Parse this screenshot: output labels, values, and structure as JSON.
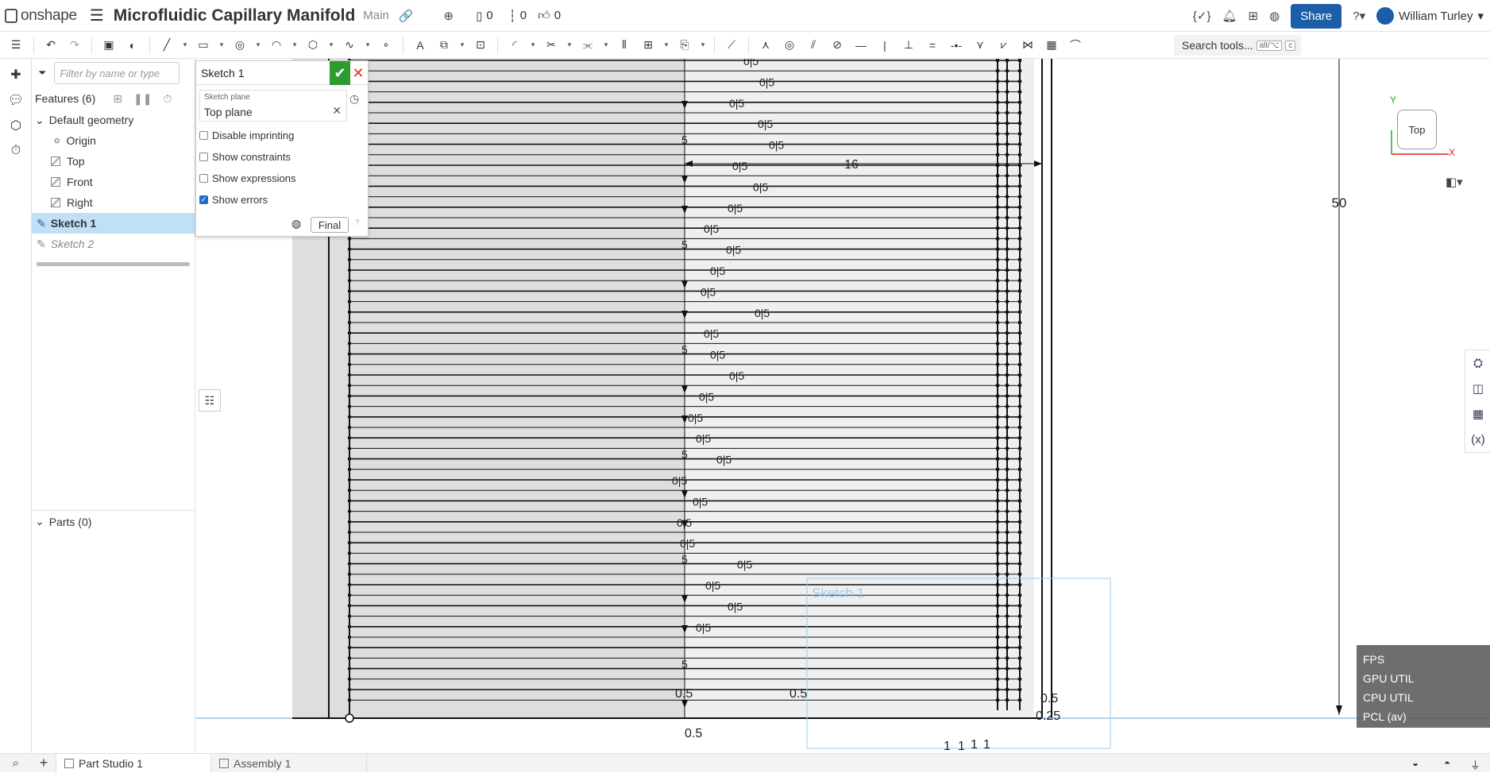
{
  "app": {
    "brand": "onshape",
    "doc_title": "Microfluidic Capillary Manifold",
    "branch": "Main",
    "counters": {
      "versions": "0",
      "branches": "0",
      "likes": "0"
    },
    "share_label": "Share",
    "user_name": "William Turley"
  },
  "toolbar": {
    "search_label": "Search tools...",
    "search_kbd1": "alt/⌥",
    "search_kbd2": "c"
  },
  "features": {
    "filter_placeholder": "Filter by name or type",
    "header": "Features (6)",
    "default_geometry": "Default geometry",
    "items": [
      "Origin",
      "Top",
      "Front",
      "Right"
    ],
    "sketch1": "Sketch 1",
    "sketch2": "Sketch 2",
    "parts": "Parts (0)"
  },
  "sketch_dialog": {
    "title": "Sketch 1",
    "plane_label": "Sketch plane",
    "plane_value": "Top plane",
    "options": [
      {
        "label": "Disable imprinting",
        "checked": false
      },
      {
        "label": "Show constraints",
        "checked": false
      },
      {
        "label": "Show expressions",
        "checked": false
      },
      {
        "label": "Show errors",
        "checked": true
      }
    ],
    "final_label": "Final"
  },
  "viewport": {
    "viewcube_face": "Top",
    "axis_y": "Y",
    "axis_x": "X",
    "sketch_label": "Sketch 1",
    "dim_50": "50",
    "dim_16": "16",
    "dim_5": "5",
    "dim_05": "0.5",
    "dim_025": "0.25",
    "dim_1": "1",
    "dim_0_5_short": "0.5",
    "dim_05_split": "0|5"
  },
  "perf": {
    "fps": "FPS",
    "gpu": "GPU UTIL",
    "cpu": "CPU UTIL",
    "pcl": "PCL (av)"
  },
  "tabs": {
    "part_studio": "Part Studio 1",
    "assembly": "Assembly 1"
  }
}
